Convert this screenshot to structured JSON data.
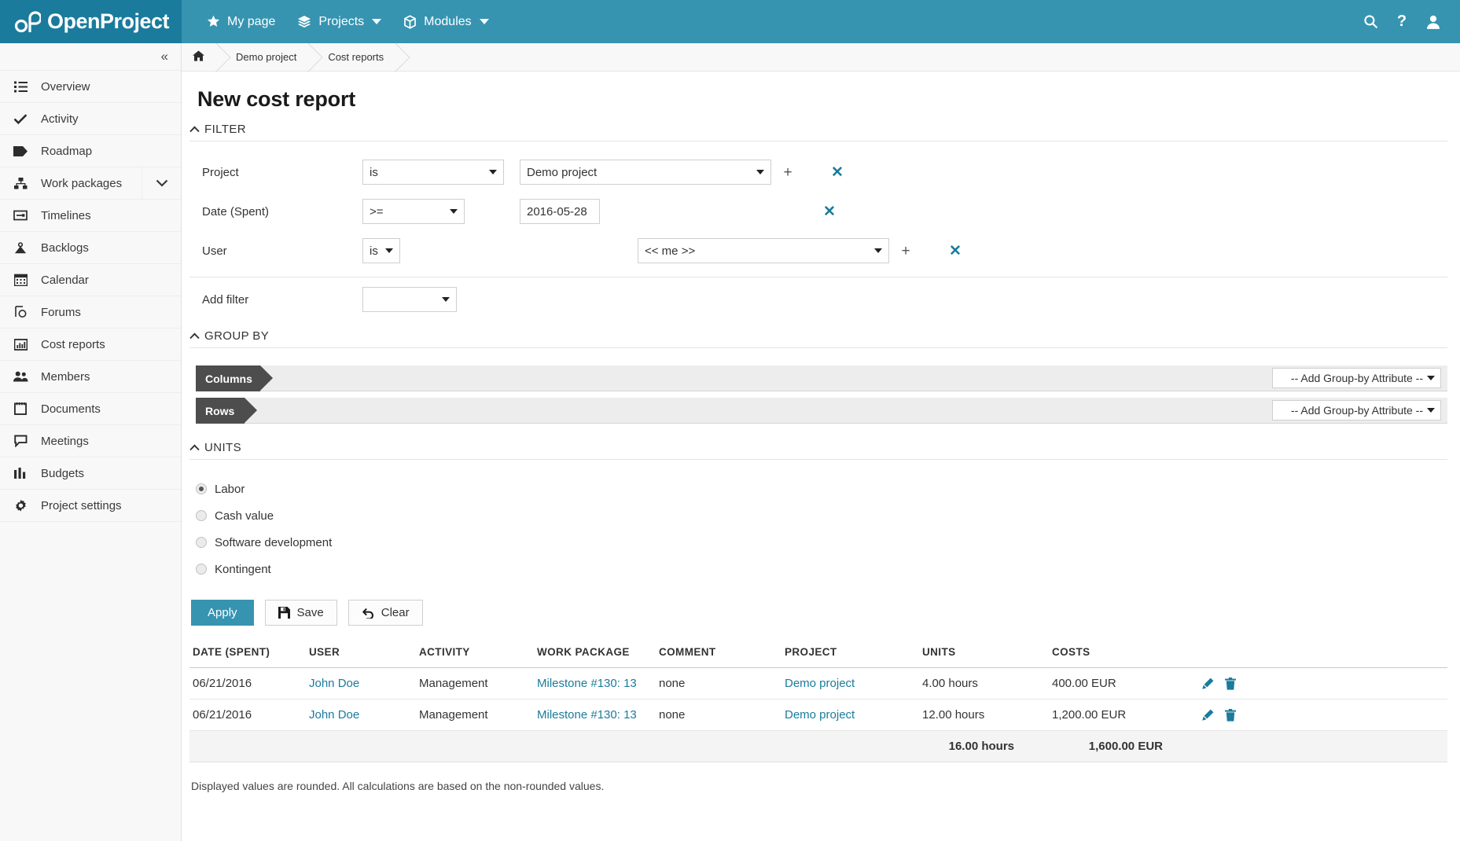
{
  "brand": {
    "name": "OpenProject",
    "accent": "#3694b1",
    "accent_dark": "#1a7b9c",
    "link": "#1a7b9c"
  },
  "topnav": {
    "items": [
      {
        "label": "My page",
        "icon": "star-icon",
        "caret": false
      },
      {
        "label": "Projects",
        "icon": "layers-icon",
        "caret": true
      },
      {
        "label": "Modules",
        "icon": "cube-icon",
        "caret": true
      }
    ],
    "right": [
      {
        "name": "search-icon"
      },
      {
        "name": "help-icon",
        "glyph": "?"
      },
      {
        "name": "user-avatar-icon"
      }
    ]
  },
  "sidebar": {
    "collapse_glyph": "«",
    "items": [
      {
        "label": "Overview",
        "icon": "list-icon"
      },
      {
        "label": "Activity",
        "icon": "check-icon"
      },
      {
        "label": "Roadmap",
        "icon": "tag-icon"
      },
      {
        "label": "Work packages",
        "icon": "hierarchy-icon",
        "expandable": true
      },
      {
        "label": "Timelines",
        "icon": "timeline-icon"
      },
      {
        "label": "Backlogs",
        "icon": "backlog-icon"
      },
      {
        "label": "Calendar",
        "icon": "calendar-icon"
      },
      {
        "label": "Forums",
        "icon": "forum-icon"
      },
      {
        "label": "Cost reports",
        "icon": "chart-icon"
      },
      {
        "label": "Members",
        "icon": "people-icon"
      },
      {
        "label": "Documents",
        "icon": "document-icon"
      },
      {
        "label": "Meetings",
        "icon": "speech-bubble-icon"
      },
      {
        "label": "Budgets",
        "icon": "budget-icon"
      },
      {
        "label": "Project settings",
        "icon": "settings-icon"
      }
    ]
  },
  "breadcrumb": {
    "home_icon": "home-icon",
    "items": [
      "Demo project",
      "Cost reports"
    ]
  },
  "page": {
    "title": "New cost report"
  },
  "filter_section": {
    "heading": "FILTER",
    "chevron": "⌃",
    "rows": [
      {
        "label": "Project",
        "operator": "is",
        "value": "Demo project",
        "value_type": "select",
        "has_add": true,
        "has_remove": true
      },
      {
        "label": "Date (Spent)",
        "operator": ">=",
        "value": "2016-05-28",
        "value_type": "text",
        "has_add": false,
        "has_remove": true
      },
      {
        "label": "User",
        "operator": "is",
        "value": "<< me >>",
        "value_type": "select",
        "has_add": true,
        "has_remove": true
      }
    ],
    "add_filter_label": "Add filter",
    "add_filter_value": ""
  },
  "groupby_section": {
    "heading": "GROUP BY",
    "chevron": "⌃",
    "rows": [
      {
        "tag": "Columns",
        "select_label": "-- Add Group-by Attribute --"
      },
      {
        "tag": "Rows",
        "select_label": "-- Add Group-by Attribute --"
      }
    ]
  },
  "units_section": {
    "heading": "UNITS",
    "chevron": "⌃",
    "options": [
      {
        "label": "Labor",
        "selected": true
      },
      {
        "label": "Cash value",
        "selected": false
      },
      {
        "label": "Software development",
        "selected": false
      },
      {
        "label": "Kontingent",
        "selected": false
      }
    ]
  },
  "actions": {
    "apply": "Apply",
    "save": "Save",
    "save_icon": "floppy-disk-icon",
    "clear": "Clear",
    "clear_icon": "undo-icon"
  },
  "results": {
    "columns": [
      "DATE (SPENT)",
      "USER",
      "ACTIVITY",
      "WORK PACKAGE",
      "COMMENT",
      "PROJECT",
      "UNITS",
      "COSTS"
    ],
    "rows": [
      {
        "date": "06/21/2016",
        "user": "John Doe",
        "activity": "Management",
        "work_package": "Milestone #130: 13",
        "comment": "none",
        "project": "Demo project",
        "units": "4.00 hours",
        "costs": "400.00 EUR",
        "edit_icon": "pencil-icon",
        "delete_icon": "trash-icon"
      },
      {
        "date": "06/21/2016",
        "user": "John Doe",
        "activity": "Management",
        "work_package": "Milestone #130: 13",
        "comment": "none",
        "project": "Demo project",
        "units": "12.00 hours",
        "costs": "1,200.00 EUR",
        "edit_icon": "pencil-icon",
        "delete_icon": "trash-icon"
      }
    ],
    "total": {
      "units": "16.00 hours",
      "costs": "1,600.00 EUR"
    },
    "note": "Displayed values are rounded. All calculations are based on the non-rounded values."
  }
}
